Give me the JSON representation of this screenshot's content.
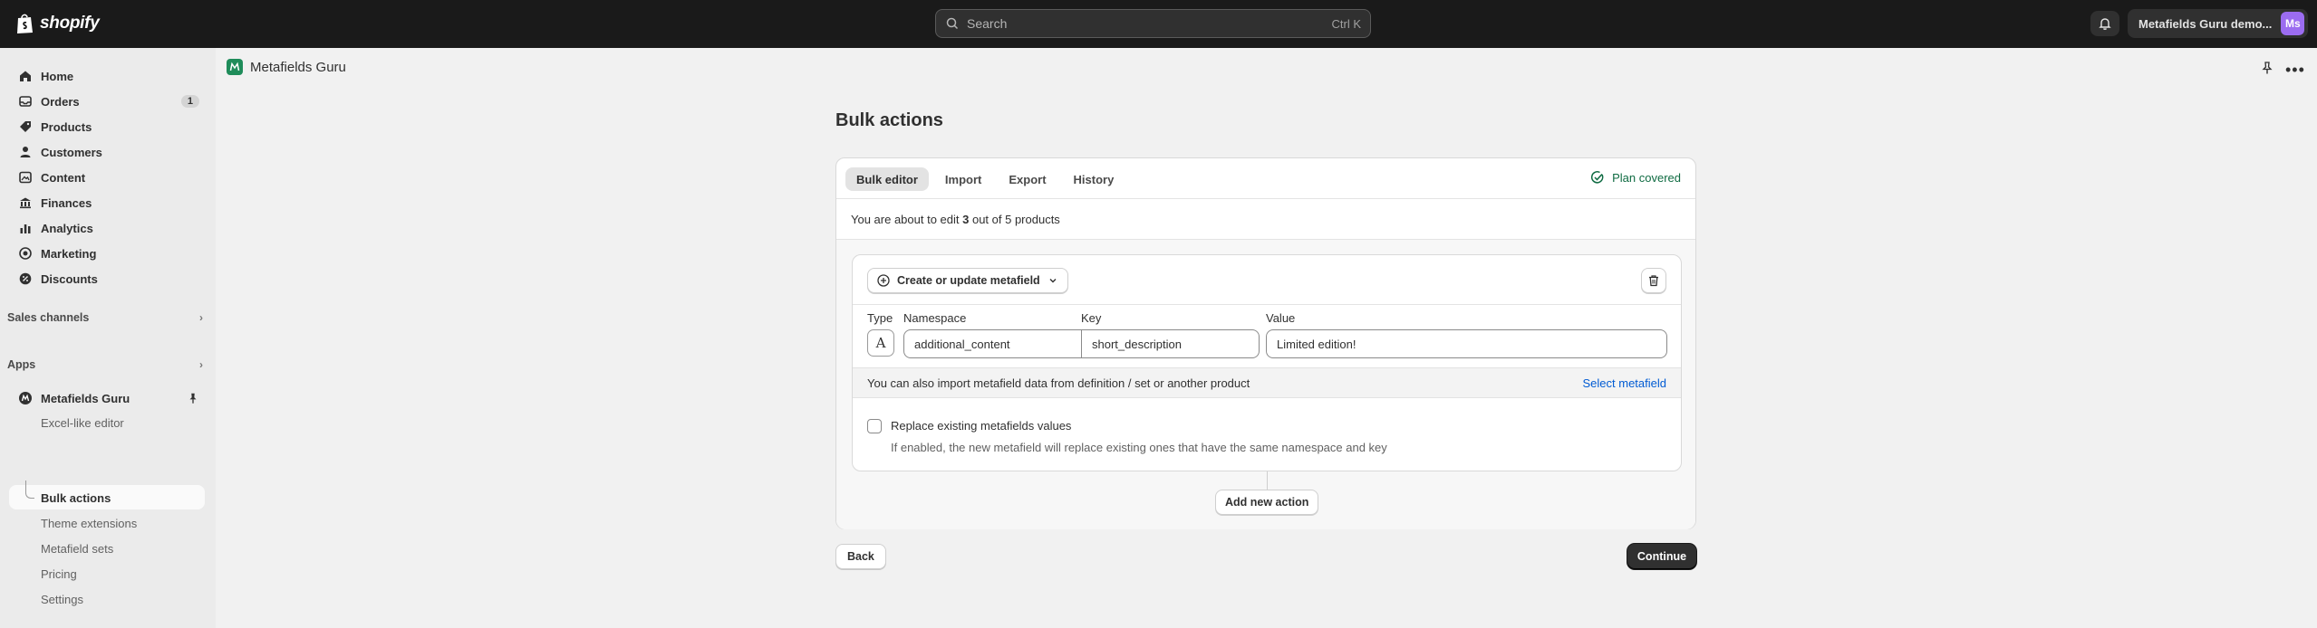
{
  "topbar": {
    "brand": "shopify",
    "search_placeholder": "Search",
    "search_shortcut": "Ctrl K",
    "store_name": "Metafields Guru demo...",
    "avatar_initials": "Ms",
    "avatar_color": "#9b6cf0"
  },
  "sidebar": {
    "items": [
      {
        "label": "Home",
        "icon": "home-icon"
      },
      {
        "label": "Orders",
        "icon": "orders-icon",
        "badge": "1"
      },
      {
        "label": "Products",
        "icon": "tag-icon"
      },
      {
        "label": "Customers",
        "icon": "person-icon"
      },
      {
        "label": "Content",
        "icon": "content-icon"
      },
      {
        "label": "Finances",
        "icon": "bank-icon"
      },
      {
        "label": "Analytics",
        "icon": "chart-icon"
      },
      {
        "label": "Marketing",
        "icon": "target-icon"
      },
      {
        "label": "Discounts",
        "icon": "discount-icon"
      }
    ],
    "sales_channels": "Sales channels",
    "apps": "Apps",
    "app_name": "Metafields Guru",
    "app_sub": [
      "Excel-like editor",
      "Bulk actions",
      "Theme extensions",
      "Metafield sets",
      "Pricing",
      "Settings"
    ],
    "active_sub": "Bulk actions"
  },
  "header": {
    "app_title": "Metafields Guru"
  },
  "page": {
    "title": "Bulk actions",
    "tabs": [
      "Bulk editor",
      "Import",
      "Export",
      "History"
    ],
    "active_tab": "Bulk editor",
    "plan_status": "Plan covered",
    "about_prefix": "You are about to edit ",
    "about_count": "3",
    "about_suffix": " out of 5 products",
    "action": {
      "dropdown_label": "Create or update metafield",
      "type_label": "Type",
      "namespace_label": "Namespace",
      "key_label": "Key",
      "value_label": "Value",
      "type_glyph": "A",
      "namespace_value": "additional_content",
      "key_value": "short_description",
      "value_value": "Limited edition!",
      "import_text": "You can also import metafield data from definition / set or another product",
      "import_link": "Select metafield",
      "checkbox_label": "Replace existing metafields values",
      "checkbox_help": "If enabled, the new metafield will replace existing ones that have the same namespace and key",
      "checkbox_checked": false
    },
    "add_action": "Add new action",
    "back": "Back",
    "continue": "Continue"
  },
  "colors": {
    "accent_link": "#005bd3",
    "plan_green": "#0f6b42",
    "primary_button": "#303030"
  }
}
